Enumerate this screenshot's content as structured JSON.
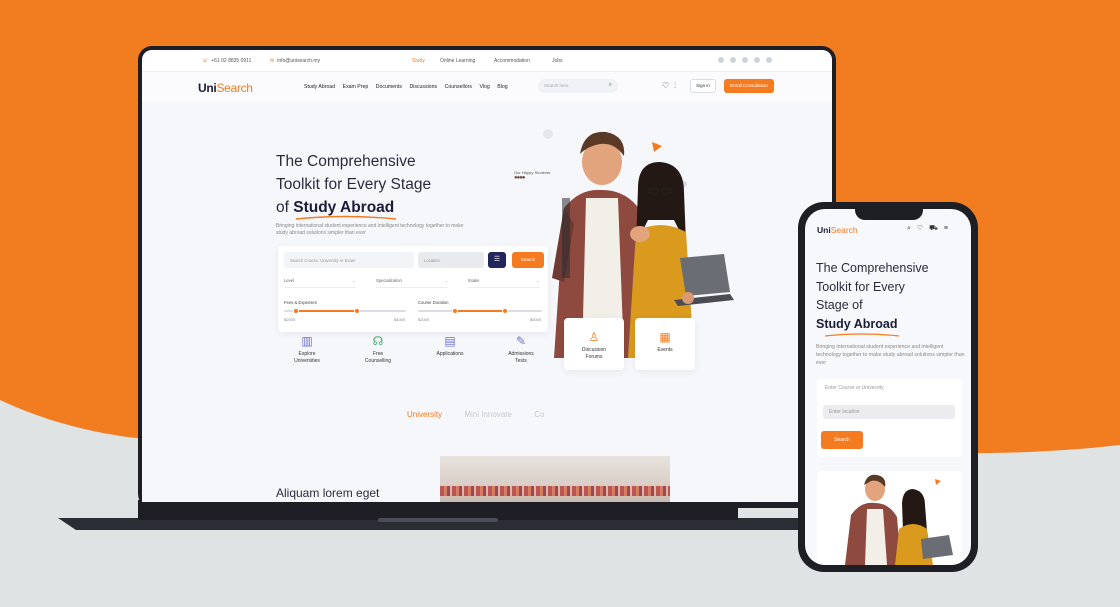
{
  "colors": {
    "accent": "#f47b20",
    "navy": "#23265a",
    "backdrop_orange": "#f27d21",
    "backdrop_gray": "#dfe3e3"
  },
  "topbar": {
    "phone": "+61 02 8835 0911",
    "email": "info@unisearch.my",
    "links": [
      "Study",
      "Online Learning",
      "Accommodation",
      "Jobs"
    ]
  },
  "nav": {
    "logo_main": "Uni",
    "logo_accent": "Search",
    "menu": [
      "Study Abroad",
      "Exam Prep",
      "Documents",
      "Discussions",
      "Counsellors",
      "Vlog",
      "Blog"
    ],
    "search_placeholder": "Search here",
    "sign_in": "Sign in",
    "cta": "Enroll Consultation"
  },
  "hero": {
    "title_line1": "The Comprehensive",
    "title_line2": "Toolkit for Every Stage",
    "title_line3_prefix": "of ",
    "title_accent": "Study Abroad",
    "description": "Bringing international student experience and intelligent technology together to make study abroad solutions simpler than ever",
    "reviews_label": "Our Happy Students"
  },
  "search_card": {
    "input_placeholder": "Search Course, University or Exam",
    "location_placeholder": "Location",
    "search_button": "Search",
    "selects": [
      "Level",
      "Specialization",
      "Intake"
    ],
    "fees_label": "Fees & Expenses",
    "duration_label": "Course Duration",
    "fees_min": "$2000",
    "fees_max": "$4000",
    "duration_min": "$2000",
    "duration_max": "$5000",
    "fees_range": [
      0.1,
      0.6
    ],
    "duration_range": [
      0.3,
      0.7
    ]
  },
  "features": [
    {
      "label_1": "Explore",
      "label_2": "Universities",
      "icon": "building-icon"
    },
    {
      "label_1": "Free",
      "label_2": "Counselling",
      "icon": "headset-icon"
    },
    {
      "label_1": "Applications",
      "label_2": "",
      "icon": "document-icon"
    },
    {
      "label_1": "Admissions",
      "label_2": "Tests",
      "icon": "test-icon"
    },
    {
      "label_1": "Discussion",
      "label_2": "Forums",
      "icon": "forum-icon"
    },
    {
      "label_1": "Events",
      "label_2": "",
      "icon": "calendar-icon"
    }
  ],
  "tabs": [
    "University",
    "Mini Innovate",
    "Co"
  ],
  "section_heading": "Aliquam lorem eget",
  "phone": {
    "logo_main": "Uni",
    "logo_accent": "Search",
    "title_line1": "The Comprehensive",
    "title_line2": "Toolkit for Every",
    "title_line3": "Stage of",
    "title_accent": "Study Abroad",
    "description": "Bringing international student experience and intelligent technology together to make study abroad solutions simpler than ever",
    "input_placeholder": "Enter Course or University",
    "location_placeholder": "Enter location",
    "search_button": "Search"
  }
}
